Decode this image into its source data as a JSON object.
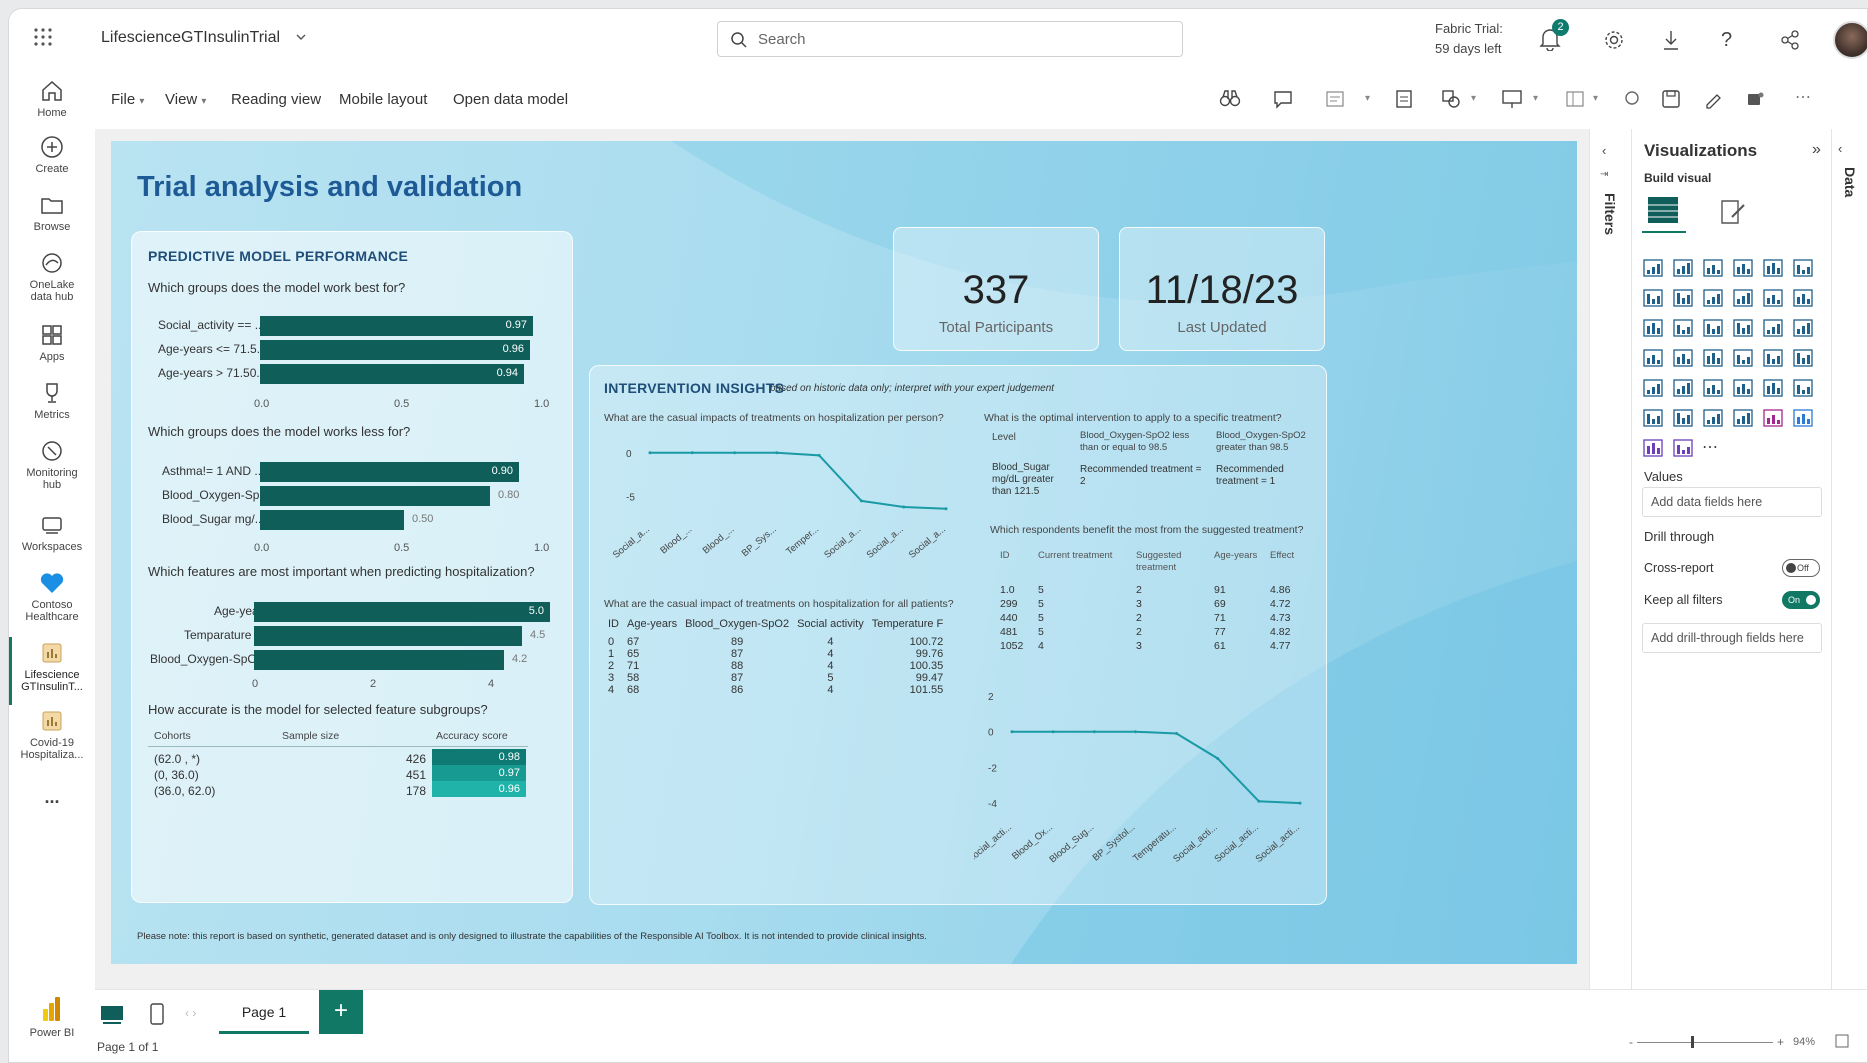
{
  "topbar": {
    "workspace_title": "LifescienceGTInsulinTrial",
    "search_placeholder": "Search",
    "trial_line1": "Fabric Trial:",
    "trial_line2": "59 days left",
    "notification_count": "2"
  },
  "left_rail": [
    {
      "label": "Home",
      "icon": "home-icon"
    },
    {
      "label": "Create",
      "icon": "plus-circle-icon"
    },
    {
      "label": "Browse",
      "icon": "folder-icon"
    },
    {
      "label": "OneLake data hub",
      "icon": "onelake-icon"
    },
    {
      "label": "Apps",
      "icon": "apps-icon"
    },
    {
      "label": "Metrics",
      "icon": "trophy-icon"
    },
    {
      "label": "Monitoring hub",
      "icon": "monitor-icon"
    },
    {
      "label": "Workspaces",
      "icon": "workspaces-icon"
    },
    {
      "label": "Contoso Healthcare",
      "icon": "heart-icon"
    },
    {
      "label": "Lifescience GTInsulinT...",
      "icon": "report-icon"
    },
    {
      "label": "Covid-19 Hospitaliza...",
      "icon": "report-icon"
    },
    {
      "label": "...",
      "icon": "more-icon"
    },
    {
      "label": "Power BI",
      "icon": "powerbi-icon"
    }
  ],
  "commandbar": {
    "file": "File",
    "view": "View",
    "reading_view": "Reading view",
    "mobile_layout": "Mobile layout",
    "open_data_model": "Open data model"
  },
  "report": {
    "title": "Trial analysis and validation",
    "footer_note": "Please note: this report is based on synthetic, generated dataset and is only designed to illustrate the capabilities of the Responsible AI Toolbox. It is not intended to provide clinical insights.",
    "predictive": {
      "heading": "PREDICTIVE MODEL PERFORMANCE",
      "q1": "Which groups does the model work best for?",
      "best": [
        {
          "label": "Social_activity == ...",
          "value": "0.97",
          "num": 0.97
        },
        {
          "label": "Age-years <= 71.5...",
          "value": "0.96",
          "num": 0.96
        },
        {
          "label": "Age-years > 71.50...",
          "value": "0.94",
          "num": 0.94
        }
      ],
      "axis1": [
        "0.0",
        "0.5",
        "1.0"
      ],
      "q2": "Which groups does the model works less for?",
      "worst": [
        {
          "label": "Asthma!= 1 AND ...",
          "value": "0.90",
          "num": 0.9
        },
        {
          "label": "Blood_Oxygen-Sp...",
          "value": "0.80",
          "num": 0.8
        },
        {
          "label": "Blood_Sugar mg/...",
          "value": "0.50",
          "num": 0.5
        }
      ],
      "axis2": [
        "0.0",
        "0.5",
        "1.0"
      ],
      "q3": "Which features are most important when predicting hospitalization?",
      "features": [
        {
          "label": "Age-years",
          "value": "5.0",
          "num": 5.0
        },
        {
          "label": "Temparature F",
          "value": "4.5",
          "num": 4.5
        },
        {
          "label": "Blood_Oxygen-SpO2",
          "value": "4.2",
          "num": 4.2
        }
      ],
      "axis3": [
        "0",
        "2",
        "4"
      ],
      "q4": "How accurate is the model for selected feature subgroups?",
      "acc_headers": [
        "Cohorts",
        "Sample size",
        "Accuracy score"
      ],
      "acc_rows": [
        {
          "cohort": "(62.0 , *)",
          "size": "426",
          "score": "0.98"
        },
        {
          "cohort": "(0, 36.0)",
          "size": "451",
          "score": "0.97"
        },
        {
          "cohort": "(36.0, 62.0)",
          "size": "178",
          "score": "0.96"
        }
      ]
    },
    "kpis": [
      {
        "value": "337",
        "label": "Total Participants"
      },
      {
        "value": "11/18/23",
        "label": "Last Updated"
      }
    ],
    "intervention": {
      "heading": "INTERVENTION INSIGHTS",
      "subheading": "based on historic data only; interpret with your expert judgement",
      "q_causal_person": "What are the casual impacts of treatments on hospitalization per person?",
      "line1_y_ticks": [
        "0",
        "-5"
      ],
      "line1_x": [
        "Social_a...",
        "Blood_...",
        "Blood_...",
        "BP_Sys...",
        "Temper...",
        "Social_a...",
        "Social_a...",
        "Social_a..."
      ],
      "q_causal_all": "What are the casual impact of treatments on hospitalization for all patients?",
      "all_headers": [
        "ID",
        "Age-years",
        "Blood_Oxygen-SpO2",
        "Social activity",
        "Temperature F"
      ],
      "all_rows": [
        [
          "0",
          "67",
          "89",
          "4",
          "100.72"
        ],
        [
          "1",
          "65",
          "87",
          "4",
          "99.76"
        ],
        [
          "2",
          "71",
          "88",
          "4",
          "100.35"
        ],
        [
          "3",
          "58",
          "87",
          "5",
          "99.47"
        ],
        [
          "4",
          "68",
          "86",
          "4",
          "101.55"
        ]
      ],
      "q_optimal": "What is the optimal intervention to apply to a specific treatment?",
      "opt_level": "Level",
      "opt_col1": "Blood_Oxygen-SpO2 less than or equal to 98.5",
      "opt_col2": "Blood_Oxygen-SpO2 greater than 98.5",
      "opt_row_label": "Blood_Sugar mg/dL greater than 121.5",
      "opt_val1": "Recommended treatment = 2",
      "opt_val2": "Recommended treatment = 1",
      "q_respondents": "Which respondents benefit the most from the suggested treatment?",
      "resp_headers": [
        "ID",
        "Current treatment",
        "Suggested treatment",
        "Age-years",
        "Effect"
      ],
      "resp_rows": [
        [
          "1.0",
          "5",
          "2",
          "91",
          "4.86"
        ],
        [
          "299",
          "5",
          "3",
          "69",
          "4.72"
        ],
        [
          "440",
          "5",
          "2",
          "71",
          "4.73"
        ],
        [
          "481",
          "5",
          "2",
          "77",
          "4.82"
        ],
        [
          "1052",
          "4",
          "3",
          "61",
          "4.77"
        ]
      ],
      "line2_y_ticks": [
        "2",
        "0",
        "-2",
        "-4"
      ],
      "line2_x": [
        "Social_acti...",
        "Blood_Ox...",
        "Blood_Sug...",
        "BP_Systol...",
        "Temperatu...",
        "Social_acti...",
        "Social_acti...",
        "Social_acti..."
      ]
    }
  },
  "filters_label": "Filters",
  "viz_pane": {
    "title": "Visualizations",
    "build_visual": "Build visual",
    "values_label": "Values",
    "add_data_fields": "Add data fields here",
    "drill_through": "Drill through",
    "cross_report": "Cross-report",
    "cross_report_state": "Off",
    "keep_all_filters": "Keep all filters",
    "keep_all_filters_state": "On",
    "add_drill_fields": "Add drill-through fields here"
  },
  "data_label": "Data",
  "bottombar": {
    "page_tab": "Page 1",
    "page_count": "Page 1 of 1",
    "zoom": "94%"
  },
  "chart_data": [
    {
      "type": "bar",
      "title": "Which groups does the model work best for?",
      "categories": [
        "Social_activity == ...",
        "Age-years <= 71.5...",
        "Age-years > 71.50..."
      ],
      "values": [
        0.97,
        0.96,
        0.94
      ],
      "xlim": [
        0,
        1
      ]
    },
    {
      "type": "bar",
      "title": "Which groups does the model works less for?",
      "categories": [
        "Asthma!= 1 AND ...",
        "Blood_Oxygen-Sp...",
        "Blood_Sugar mg/..."
      ],
      "values": [
        0.9,
        0.8,
        0.5
      ],
      "xlim": [
        0,
        1
      ]
    },
    {
      "type": "bar",
      "title": "Which features are most important when predicting hospitalization?",
      "categories": [
        "Age-years",
        "Temparature F",
        "Blood_Oxygen-SpO2"
      ],
      "values": [
        5.0,
        4.5,
        4.2
      ],
      "xlim": [
        0,
        5
      ]
    },
    {
      "type": "line",
      "title": "What are the casual impacts of treatments on hospitalization per person?",
      "categories": [
        "Social_a...",
        "Blood_...",
        "Blood_...",
        "BP_Sys...",
        "Temper...",
        "Social_a...",
        "Social_a...",
        "Social_a..."
      ],
      "values": [
        0,
        0,
        0,
        0,
        -0.3,
        -5.5,
        -6.2,
        -6.4
      ],
      "ylim": [
        -7,
        1
      ]
    },
    {
      "type": "line",
      "title": "Which respondents benefit the most from the suggested treatment?",
      "categories": [
        "Social_acti...",
        "Blood_Ox...",
        "Blood_Sug...",
        "BP_Systol...",
        "Temperatu...",
        "Social_acti...",
        "Social_acti...",
        "Social_acti..."
      ],
      "values": [
        0,
        0,
        0,
        0,
        -0.1,
        -1.5,
        -3.9,
        -4.0
      ],
      "ylim": [
        -4.5,
        2
      ]
    }
  ]
}
